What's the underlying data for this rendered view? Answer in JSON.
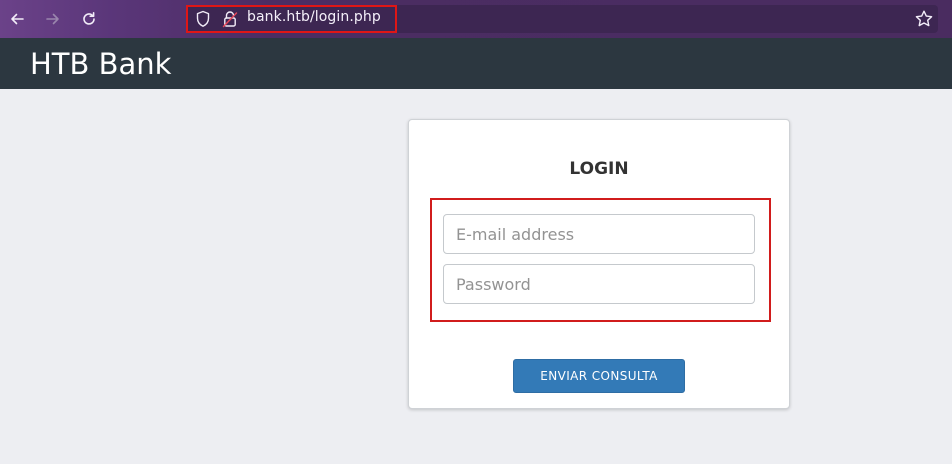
{
  "browser": {
    "url": "bank.htb/login.php",
    "icons": {
      "back": "back-arrow-icon",
      "forward": "forward-arrow-icon",
      "reload": "reload-icon",
      "shield": "tracking-protection-shield-icon",
      "lock": "insecure-lock-icon",
      "star": "bookmark-star-icon"
    }
  },
  "site": {
    "title": "HTB Bank"
  },
  "login": {
    "heading": "LOGIN",
    "email_placeholder": "E-mail address",
    "password_placeholder": "Password",
    "submit_label": "ENVIAR CONSULTA"
  },
  "colors": {
    "toolbar": "#4a2c60",
    "header": "#2c3740",
    "page_bg": "#edeef2",
    "primary_button": "#337ab7",
    "highlight": "#e01616"
  }
}
